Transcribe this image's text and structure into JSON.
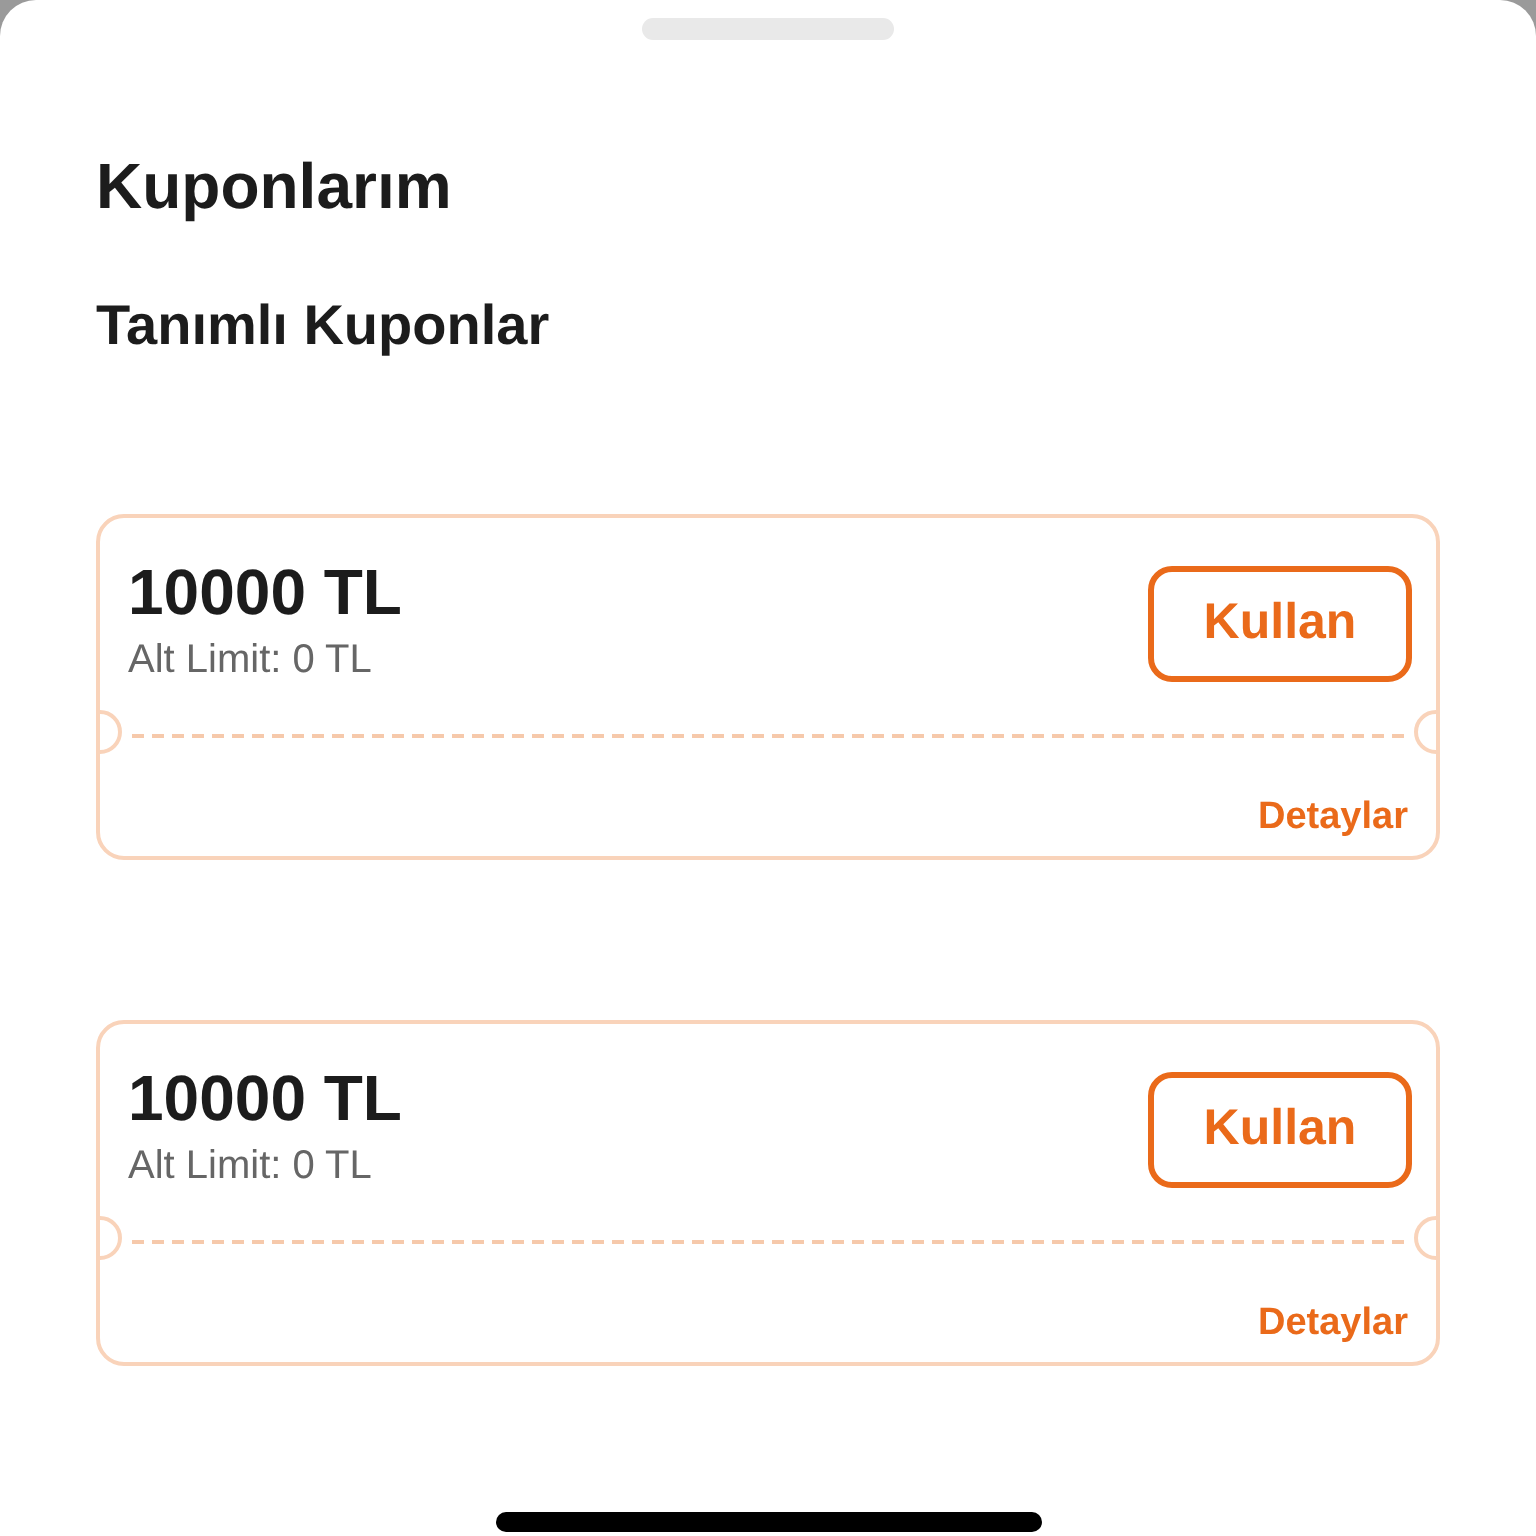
{
  "title": "Kuponlarım",
  "section_title": "Tanımlı Kuponlar",
  "coupons": [
    {
      "amount": "10000 TL",
      "limit": "Alt Limit: 0 TL",
      "action": "Kullan",
      "details": "Detaylar"
    },
    {
      "amount": "10000 TL",
      "limit": "Alt Limit: 0 TL",
      "action": "Kullan",
      "details": "Detaylar"
    }
  ]
}
